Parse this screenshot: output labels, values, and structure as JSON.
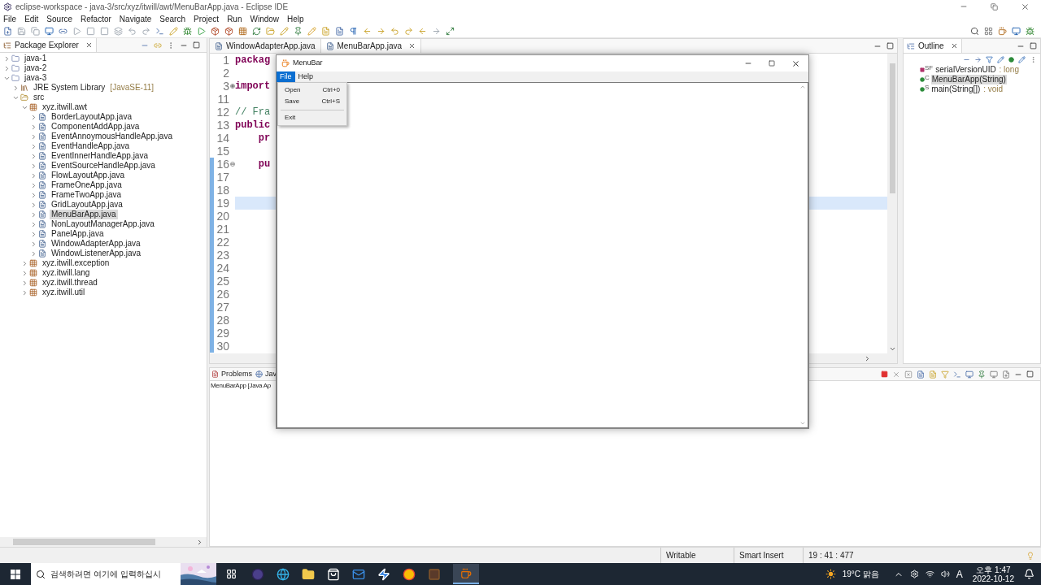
{
  "window": {
    "title": "eclipse-workspace - java-3/src/xyz/itwill/awt/MenuBarApp.java - Eclipse IDE"
  },
  "menu": [
    "File",
    "Edit",
    "Source",
    "Refactor",
    "Navigate",
    "Search",
    "Project",
    "Run",
    "Window",
    "Help"
  ],
  "package_explorer": {
    "title": "Package Explorer",
    "tree": [
      {
        "label": "java-1",
        "kind": "project",
        "expanded": false,
        "selected": false
      },
      {
        "label": "java-2",
        "kind": "project",
        "expanded": false,
        "selected": false
      },
      {
        "label": "java-3",
        "kind": "project",
        "expanded": true,
        "selected": false,
        "children": [
          {
            "label": "JRE System Library",
            "suffix": "[JavaSE-11]",
            "kind": "library",
            "expanded": false,
            "selected": false
          },
          {
            "label": "src",
            "kind": "folder",
            "expanded": true,
            "selected": false,
            "children": [
              {
                "label": "xyz.itwill.awt",
                "kind": "package",
                "expanded": true,
                "selected": false,
                "children": [
                  {
                    "label": "BorderLayoutApp.java",
                    "kind": "file",
                    "expanded": false,
                    "selected": false
                  },
                  {
                    "label": "ComponentAddApp.java",
                    "kind": "file",
                    "expanded": false,
                    "selected": false
                  },
                  {
                    "label": "EventAnnoymousHandleApp.java",
                    "kind": "file",
                    "expanded": false,
                    "selected": false
                  },
                  {
                    "label": "EventHandleApp.java",
                    "kind": "file",
                    "expanded": false,
                    "selected": false
                  },
                  {
                    "label": "EventInnerHandleApp.java",
                    "kind": "file",
                    "expanded": false,
                    "selected": false
                  },
                  {
                    "label": "EventSourceHandleApp.java",
                    "kind": "file",
                    "expanded": false,
                    "selected": false
                  },
                  {
                    "label": "FlowLayoutApp.java",
                    "kind": "file",
                    "expanded": false,
                    "selected": false
                  },
                  {
                    "label": "FrameOneApp.java",
                    "kind": "file",
                    "expanded": false,
                    "selected": false
                  },
                  {
                    "label": "FrameTwoApp.java",
                    "kind": "file",
                    "expanded": false,
                    "selected": false
                  },
                  {
                    "label": "GridLayoutApp.java",
                    "kind": "file",
                    "expanded": false,
                    "selected": false
                  },
                  {
                    "label": "MenuBarApp.java",
                    "kind": "file",
                    "expanded": false,
                    "selected": true
                  },
                  {
                    "label": "NonLayoutManagerApp.java",
                    "kind": "file",
                    "expanded": false,
                    "selected": false
                  },
                  {
                    "label": "PanelApp.java",
                    "kind": "file",
                    "expanded": false,
                    "selected": false
                  },
                  {
                    "label": "WindowAdapterApp.java",
                    "kind": "file",
                    "expanded": false,
                    "selected": false
                  },
                  {
                    "label": "WindowListenerApp.java",
                    "kind": "file",
                    "expanded": false,
                    "selected": false
                  }
                ]
              },
              {
                "label": "xyz.itwill.exception",
                "kind": "package",
                "expanded": false,
                "selected": false
              },
              {
                "label": "xyz.itwill.lang",
                "kind": "package",
                "expanded": false,
                "selected": false
              },
              {
                "label": "xyz.itwill.thread",
                "kind": "package",
                "expanded": false,
                "selected": false
              },
              {
                "label": "xyz.itwill.util",
                "kind": "package",
                "expanded": false,
                "selected": false
              }
            ]
          }
        ]
      }
    ]
  },
  "editor": {
    "tabs": [
      {
        "label": "WindowAdapterApp.java",
        "selected": false
      },
      {
        "label": "MenuBarApp.java",
        "selected": true
      }
    ],
    "lines": [
      {
        "number": "1",
        "code": "packag",
        "kind": "keyword",
        "current": false,
        "changed": false
      },
      {
        "number": "2",
        "current": false,
        "changed": false
      },
      {
        "number": "3",
        "code": "import",
        "kind": "keyword",
        "folded": true,
        "current": false,
        "changed": false
      },
      {
        "number": "11",
        "current": false,
        "changed": false
      },
      {
        "number": "12",
        "code": "// Fra",
        "kind": "comment",
        "current": false,
        "changed": false
      },
      {
        "number": "13",
        "code": "public",
        "kind": "keyword",
        "current": false,
        "changed": false
      },
      {
        "number": "14",
        "code": "    pr",
        "kind": "keyword",
        "current": false,
        "changed": false
      },
      {
        "number": "15",
        "current": false,
        "changed": false
      },
      {
        "number": "16",
        "code": "    pu",
        "kind": "keyword",
        "folded": false,
        "current": false,
        "changed": true
      },
      {
        "number": "17",
        "current": false,
        "changed": true
      },
      {
        "number": "18",
        "current": false,
        "changed": true
      },
      {
        "number": "19",
        "current": true,
        "changed": true
      },
      {
        "number": "20",
        "current": false,
        "changed": true
      },
      {
        "number": "21",
        "current": false,
        "changed": true
      },
      {
        "number": "22",
        "current": false,
        "changed": true
      },
      {
        "number": "23",
        "current": false,
        "changed": true
      },
      {
        "number": "24",
        "current": false,
        "changed": true
      },
      {
        "number": "25",
        "current": false,
        "changed": true
      },
      {
        "number": "26",
        "current": false,
        "changed": true
      },
      {
        "number": "27",
        "current": false,
        "changed": true
      },
      {
        "number": "28",
        "current": false,
        "changed": true
      },
      {
        "number": "29",
        "current": false,
        "changed": true
      },
      {
        "number": "30",
        "current": false,
        "changed": true
      }
    ]
  },
  "outline": {
    "title": "Outline",
    "items": [
      {
        "name": "serialVersionUID",
        "badge": "SF",
        "type": " : long",
        "kind": "field",
        "selected": false
      },
      {
        "name": "MenuBarApp(String)",
        "badge": "C",
        "kind": "constructor",
        "selected": true
      },
      {
        "name": "main(String[])",
        "badge": "S",
        "type": " : void",
        "kind": "method",
        "selected": false
      }
    ]
  },
  "bottom_panel": {
    "tabs": [
      "Problems",
      "Jav"
    ],
    "console_title": "MenuBarApp [Java Ap"
  },
  "status_bar": [
    "Writable",
    "Smart Insert",
    "19 : 41 : 477"
  ],
  "app_window": {
    "title": "MenuBar",
    "menus": [
      {
        "label": "File",
        "selected": true
      },
      {
        "label": "Help",
        "selected": false
      }
    ],
    "dropdown": [
      {
        "kind": "item",
        "label": "Open",
        "shortcut": "Ctrl+0"
      },
      {
        "kind": "item",
        "label": "Save",
        "shortcut": "Ctrl+S"
      },
      {
        "kind": "separator"
      },
      {
        "kind": "item",
        "label": "Exit"
      }
    ]
  },
  "taskbar": {
    "search_placeholder": "검색하려면 여기에 입력하십시",
    "weather": "19°C 맑음",
    "input_mode": "A",
    "time": "오후 1:47",
    "date": "2022-10-12"
  }
}
